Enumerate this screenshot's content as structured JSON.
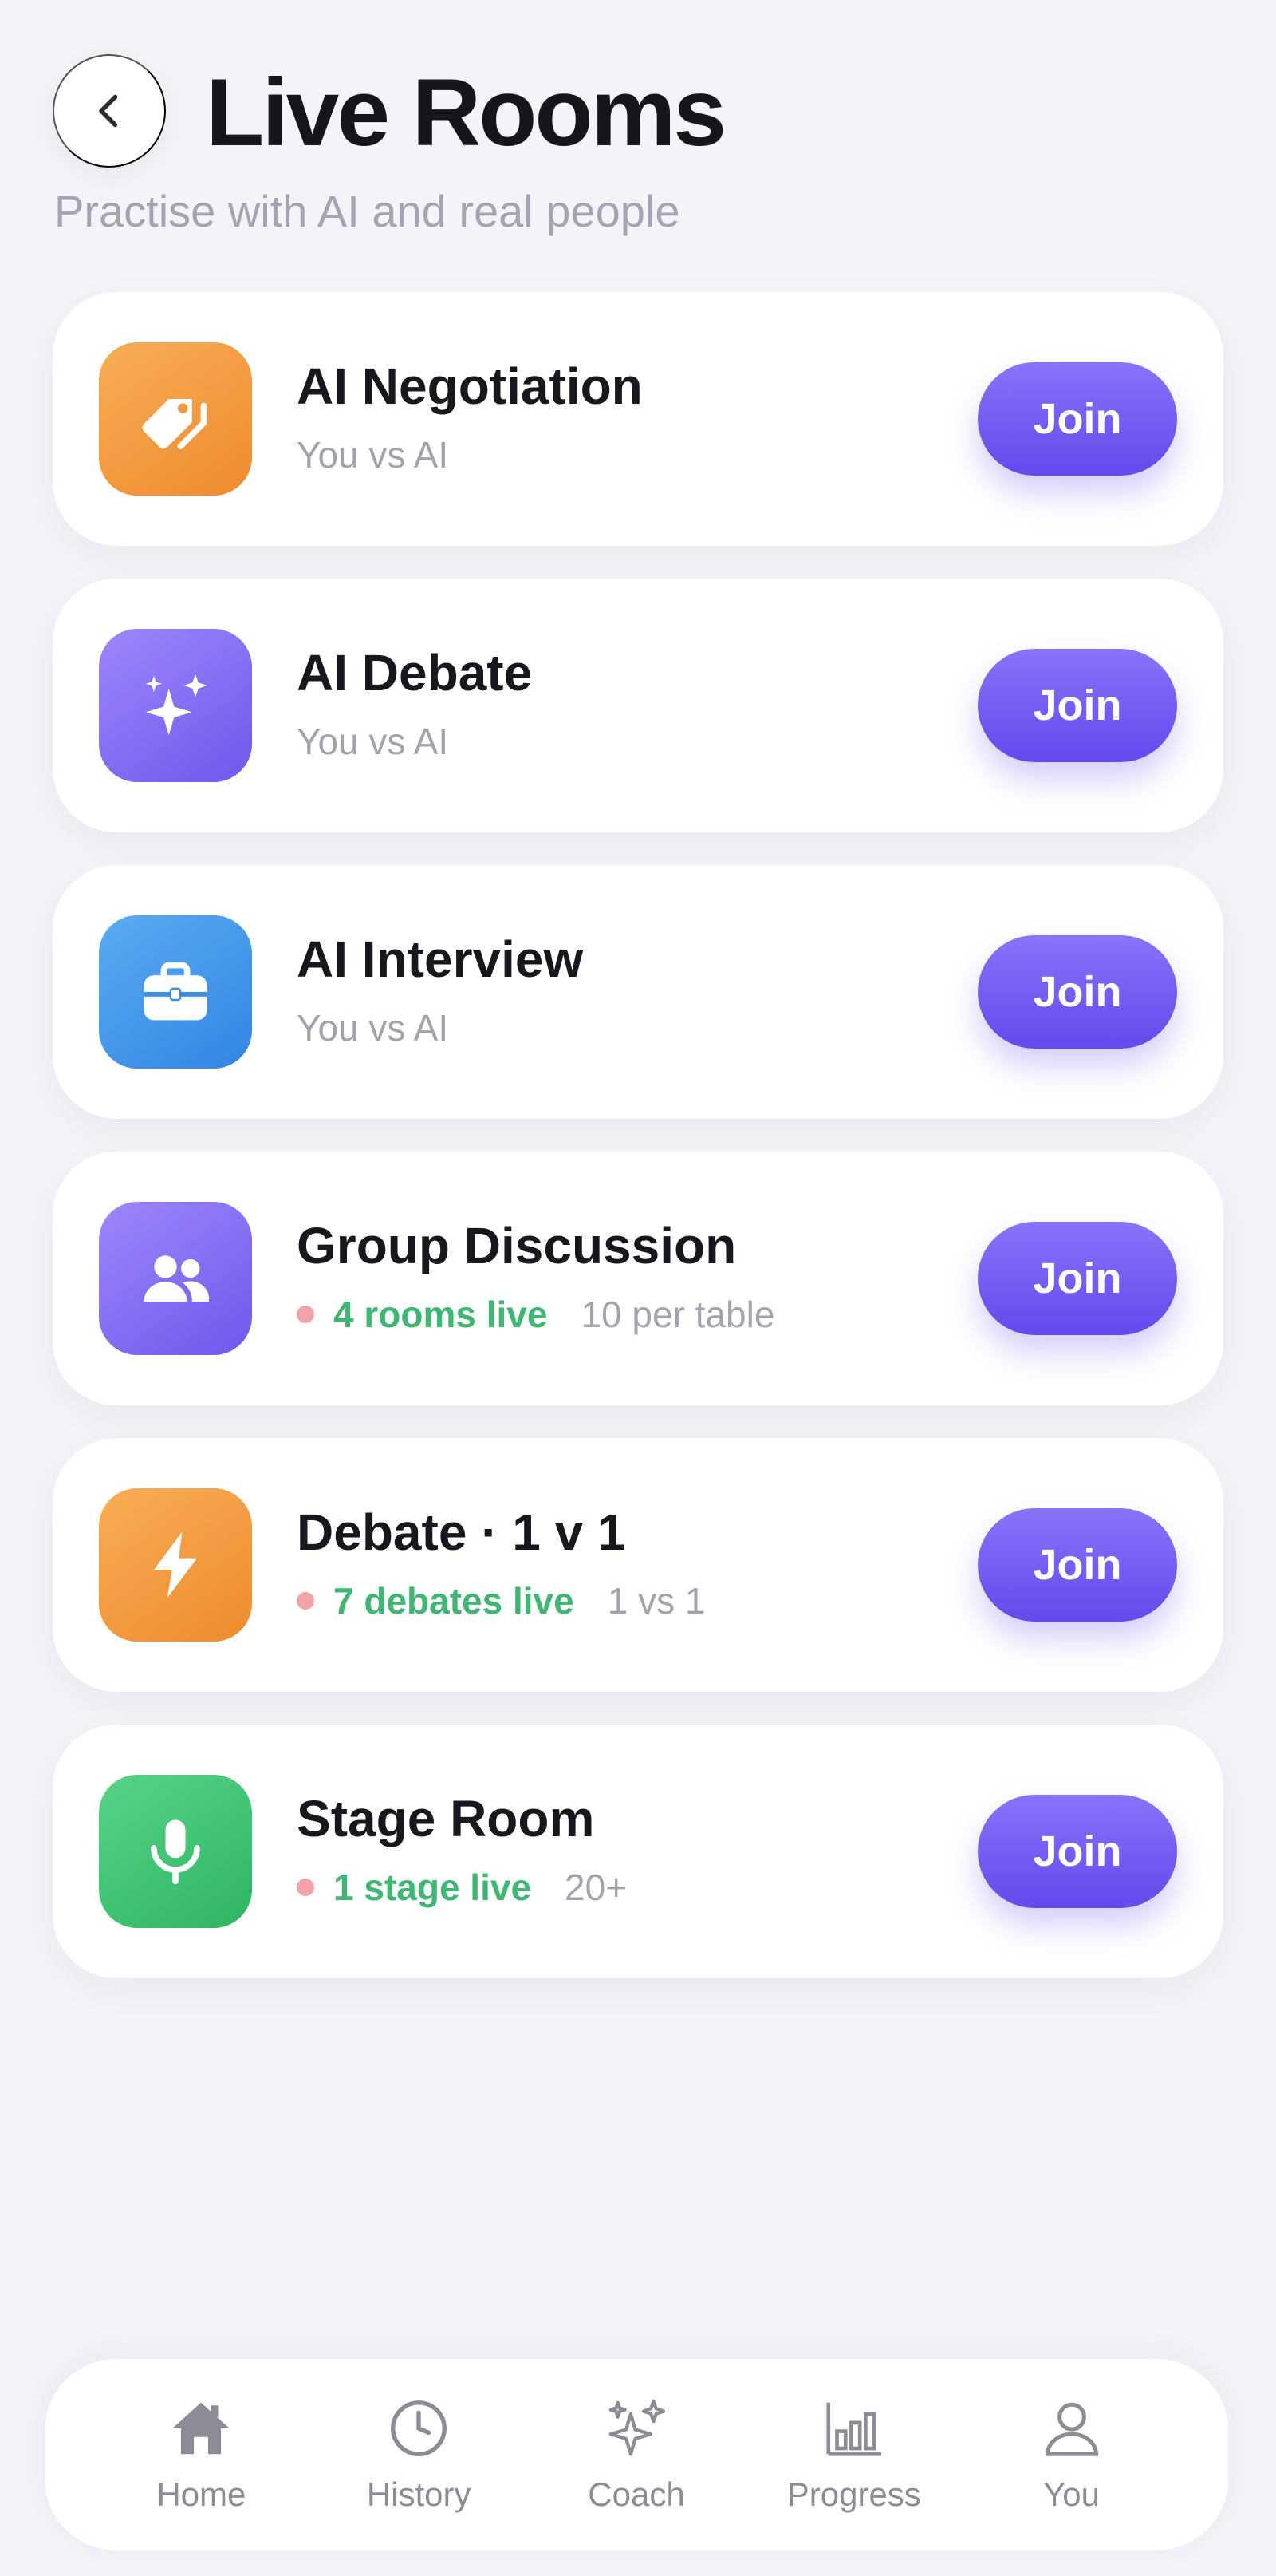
{
  "header": {
    "title": "Live Rooms",
    "subtitle": "Practise with AI and real people",
    "back_icon": "chevron-left-icon"
  },
  "rooms": [
    {
      "name": "AI Negotiation",
      "subtitle": "You vs AI",
      "icon": "tag-icon",
      "accent": "#F29A3F",
      "join_label": "Join"
    },
    {
      "name": "AI Debate",
      "subtitle": "You vs AI",
      "icon": "sparkles-icon",
      "accent": "#8370F5",
      "join_label": "Join"
    },
    {
      "name": "AI Interview",
      "subtitle": "You vs AI",
      "icon": "briefcase-icon",
      "accent": "#4097EA",
      "join_label": "Join"
    },
    {
      "name": "Group Discussion",
      "live": "4 rooms live",
      "detail": "10 per table",
      "icon": "users-icon",
      "accent": "#8370F5",
      "join_label": "Join"
    },
    {
      "name": "Debate · 1 v 1",
      "live": "7 debates live",
      "detail": "1 vs 1",
      "icon": "lightning-icon",
      "accent": "#F29A3F",
      "join_label": "Join"
    },
    {
      "name": "Stage Room",
      "live": "1 stage live",
      "detail": "20+",
      "icon": "microphone-icon",
      "accent": "#41C476",
      "join_label": "Join"
    }
  ],
  "nav": {
    "items": [
      {
        "label": "Home",
        "icon": "home-icon"
      },
      {
        "label": "History",
        "icon": "clock-icon"
      },
      {
        "label": "Coach",
        "icon": "sparkles-icon"
      },
      {
        "label": "Progress",
        "icon": "bar-chart-icon"
      },
      {
        "label": "You",
        "icon": "user-icon"
      }
    ]
  },
  "colors": {
    "background": "#F3F3F8",
    "primary": "#6D55EE",
    "live_text": "#3FB671",
    "live_dot": "#F2A3A8",
    "muted_text": "#A3A3AE"
  }
}
